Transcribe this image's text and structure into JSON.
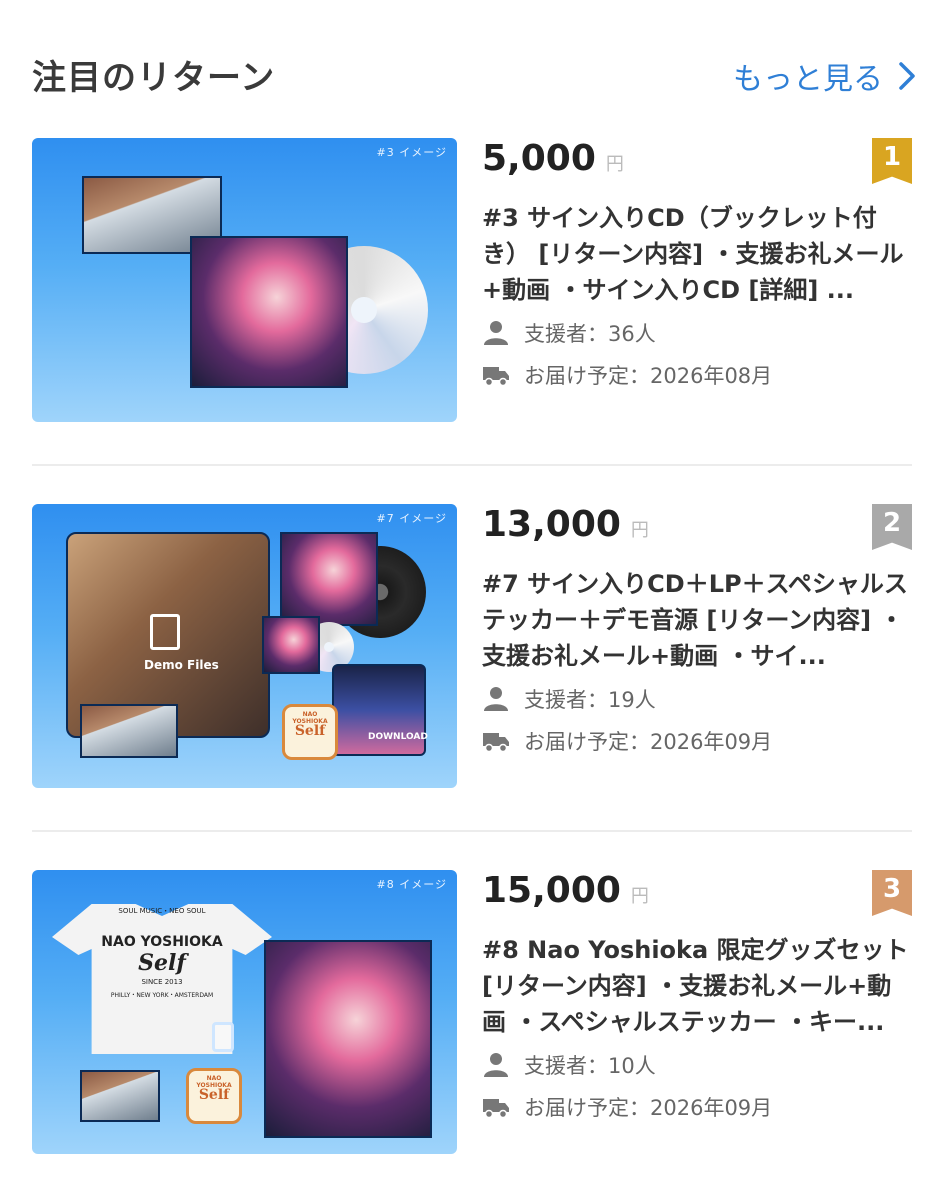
{
  "header": {
    "title": "注目のリターン",
    "more_label": "もっと見る"
  },
  "colors": {
    "link": "#2f7fd6",
    "rank_gold": "#d9a521",
    "rank_silver": "#a9a9a9",
    "rank_bronze": "#d69a6c"
  },
  "returns": [
    {
      "rank": "1",
      "thumb_tag": "#3 イメージ",
      "price": "5,000",
      "yen": "円",
      "description": "#3 サイン入りCD（ブックレット付き） [リターン内容] ・支援お礼メール+動画 ・サイン入りCD [詳細] ...",
      "supporters": "支援者：36人",
      "delivery": "お届け予定：2026年08月"
    },
    {
      "rank": "2",
      "thumb_tag": "#7 イメージ",
      "price": "13,000",
      "yen": "円",
      "description": "#7 サイン入りCD＋LP＋スペシャルステッカー＋デモ音源 [リターン内容] ・支援お礼メール+動画 ・サイ...",
      "supporters": "支援者：19人",
      "delivery": "お届け予定：2026年09月",
      "thumb_demo_label": "Demo Files",
      "thumb_download_label": "DOWNLOAD",
      "thumb_badge_top": "NAO YOSHIOKA",
      "thumb_badge_text": "Self"
    },
    {
      "rank": "3",
      "thumb_tag": "#8 イメージ",
      "price": "15,000",
      "yen": "円",
      "description": "#8 Nao Yoshioka 限定グッズセット [リターン内容] ・支援お礼メール+動画 ・スペシャルステッカー ・キー...",
      "supporters": "支援者：10人",
      "delivery": "お届け予定：2026年09月",
      "thumb_shirt_top": "SOUL MUSIC・NEO SOUL",
      "thumb_shirt_name": "NAO YOSHIOKA",
      "thumb_shirt_logo": "Self",
      "thumb_shirt_since": "SINCE 2013",
      "thumb_shirt_cities": "PHILLY・NEW YORK・AMSTERDAM",
      "thumb_badge_top": "NAO YOSHIOKA",
      "thumb_badge_text": "Self"
    }
  ]
}
